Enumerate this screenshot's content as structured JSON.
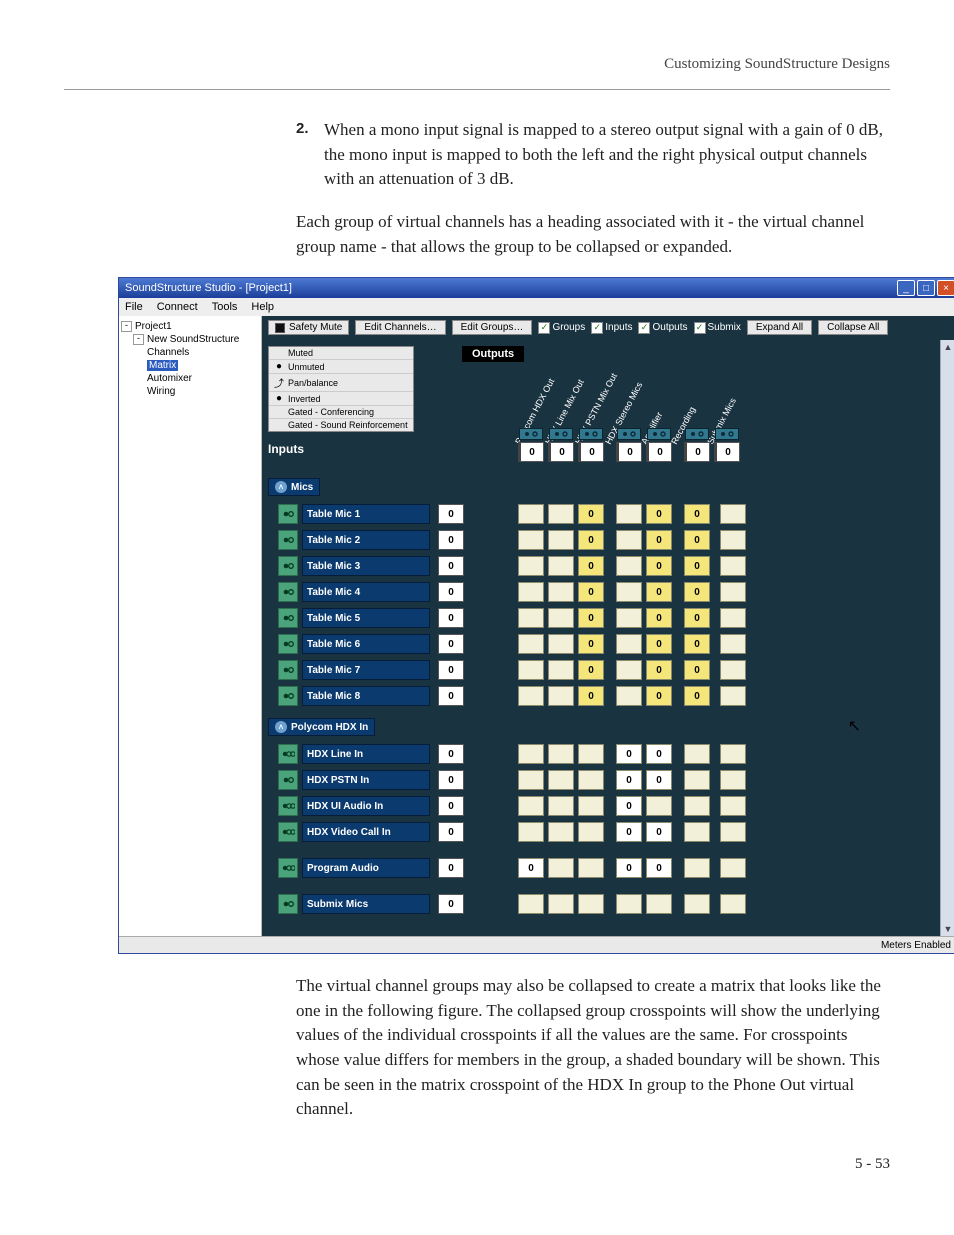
{
  "header": {
    "chapter_title": "Customizing SoundStructure Designs"
  },
  "step": {
    "number": "2.",
    "text": "When a mono input signal is mapped to a stereo output signal with a gain of 0 dB, the mono input is mapped to both the left and the right physical output channels with an attenuation of 3 dB."
  },
  "para1": "Each group of virtual channels has a heading associated with it - the virtual channel group name - that allows the group to be collapsed or expanded.",
  "para2": "The virtual channel groups may also be collapsed to create a matrix that looks like the one in the following figure. The collapsed group crosspoints will show the underlying values of the individual crosspoints if all the values are the same. For crosspoints whose value differs for members in the group, a shaded boundary will be shown. This can be seen in the matrix crosspoint of the HDX In group to the Phone Out virtual channel.",
  "footer": {
    "page": "5 - 53"
  },
  "app": {
    "title": "SoundStructure Studio - [Project1]",
    "menubar": [
      "File",
      "Connect",
      "Tools",
      "Help"
    ],
    "tree": {
      "project": "Project1",
      "device": "New SoundStructure",
      "items": [
        "Channels",
        "Matrix",
        "Automixer",
        "Wiring"
      ],
      "selected": "Matrix"
    },
    "toolbar": {
      "safety_mute": "Safety Mute",
      "edit_channels": "Edit Channels…",
      "edit_groups": "Edit Groups…",
      "groups": "Groups",
      "inputs": "Inputs",
      "outputs": "Outputs",
      "submix": "Submix",
      "expand_all": "Expand All",
      "collapse_all": "Collapse All"
    },
    "legend": [
      "Muted",
      "Unmuted",
      "Pan/balance",
      "Inverted",
      "Gated - Conferencing",
      "Gated - Sound Reinforcement"
    ],
    "outputs_label": "Outputs",
    "inputs_label": "Inputs",
    "output_cols": [
      "Polycom HDX Out",
      "HDX Line Mix Out",
      "HDX PSTN Mix Out",
      "HDX Stereo Mics",
      "Amplifier",
      "Recording",
      "Submix Mics"
    ],
    "master_gains": [
      "0",
      "0",
      "0",
      "0",
      "0",
      "0"
    ],
    "groups": [
      {
        "name": "Mics",
        "rows": [
          {
            "label": "Table Mic 1",
            "gain": "0",
            "cells": [
              "",
              "",
              "on",
              "",
              "on",
              "on",
              ""
            ]
          },
          {
            "label": "Table Mic 2",
            "gain": "0",
            "cells": [
              "",
              "",
              "on",
              "",
              "on",
              "on",
              ""
            ]
          },
          {
            "label": "Table Mic 3",
            "gain": "0",
            "cells": [
              "",
              "",
              "on",
              "",
              "on",
              "on",
              ""
            ]
          },
          {
            "label": "Table Mic 4",
            "gain": "0",
            "cells": [
              "",
              "",
              "on",
              "",
              "on",
              "on",
              ""
            ]
          },
          {
            "label": "Table Mic 5",
            "gain": "0",
            "cells": [
              "",
              "",
              "on",
              "",
              "on",
              "on",
              ""
            ]
          },
          {
            "label": "Table Mic 6",
            "gain": "0",
            "cells": [
              "",
              "",
              "on",
              "",
              "on",
              "on",
              ""
            ]
          },
          {
            "label": "Table Mic 7",
            "gain": "0",
            "cells": [
              "",
              "",
              "on",
              "",
              "on",
              "on",
              ""
            ]
          },
          {
            "label": "Table Mic 8",
            "gain": "0",
            "cells": [
              "",
              "",
              "on",
              "",
              "on",
              "on",
              ""
            ]
          }
        ]
      },
      {
        "name": "Polycom HDX In",
        "rows": [
          {
            "label": "HDX Line In",
            "gain": "0",
            "stereo": true,
            "cells": [
              "",
              "",
              "",
              "w0",
              "w0",
              "",
              ""
            ]
          },
          {
            "label": "HDX PSTN In",
            "gain": "0",
            "cells": [
              "",
              "",
              "",
              "w0",
              "w0",
              "",
              ""
            ]
          },
          {
            "label": "HDX UI Audio In",
            "gain": "0",
            "stereo": true,
            "cells": [
              "",
              "",
              "",
              "w0",
              "",
              "",
              ""
            ]
          },
          {
            "label": "HDX Video Call In",
            "gain": "0",
            "stereo": true,
            "cells": [
              "",
              "",
              "",
              "w0",
              "w0",
              "",
              ""
            ]
          }
        ]
      }
    ],
    "standalone_rows": [
      {
        "label": "Program Audio",
        "gain": "0",
        "stereo": true,
        "cells": [
          "w0",
          "",
          "",
          "w0",
          "w0",
          "",
          ""
        ]
      },
      {
        "label": "Submix Mics",
        "gain": "0",
        "cells": [
          "",
          "",
          "",
          "",
          "",
          "",
          ""
        ]
      }
    ],
    "statusbar": "Meters Enabled"
  }
}
